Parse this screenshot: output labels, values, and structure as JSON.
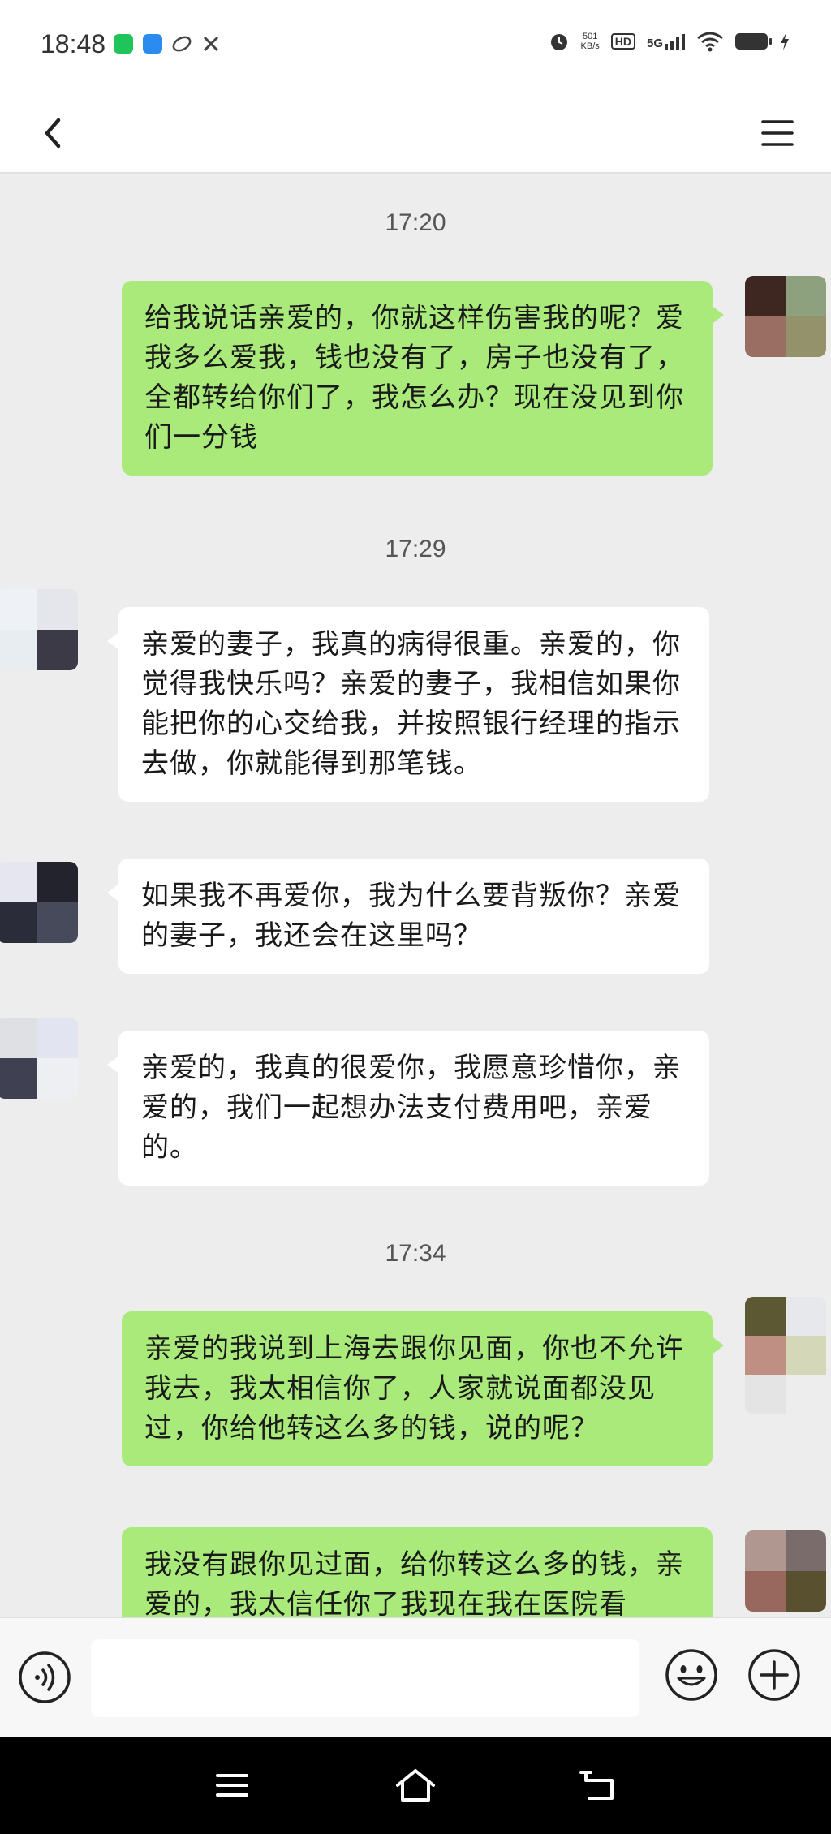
{
  "status_bar": {
    "time": "18:48",
    "net_speed_value": "501",
    "net_speed_unit": "KB/s",
    "hd_label": "HD",
    "network_label": "5G",
    "icons": [
      "green-app-icon",
      "blue-app-icon",
      "leaf-app-icon",
      "tools-icon",
      "alarm-icon",
      "hd-icon",
      "signal-icon",
      "wifi-icon",
      "battery-icon",
      "charging-icon"
    ]
  },
  "title_bar": {
    "icons": [
      "back-arrow-icon",
      "menu-icon"
    ]
  },
  "chat": {
    "timestamps": [
      "17:20",
      "17:29",
      "17:34"
    ],
    "messages": [
      {
        "side": "me",
        "text": "给我说话亲爱的，你就这样伤害我的呢？爱我多么爱我，钱也没有了，房子也没有了，全都转给你们了，我怎么办？现在没见到你们一分钱"
      },
      {
        "side": "other",
        "text": "亲爱的妻子，我真的病得很重。亲爱的，你觉得我快乐吗？亲爱的妻子，我相信如果你能把你的心交给我，并按照银行经理的指示去做，你就能得到那笔钱。"
      },
      {
        "side": "other",
        "text": "如果我不再爱你，我为什么要背叛你？亲爱的妻子，我还会在这里吗？"
      },
      {
        "side": "other",
        "text": "亲爱的，我真的很爱你，我愿意珍惜你，亲爱的，我们一起想办法支付费用吧，亲爱的。"
      },
      {
        "side": "me",
        "text": "亲爱的我说到上海去跟你见面，你也不允许我去，我太相信你了，人家就说面都没见过，你给他转这么多的钱，说的呢？"
      },
      {
        "side": "me",
        "text": "我没有跟你见过面，给你转这么多的钱，亲爱的，我太信任你了我现在我在医院看"
      }
    ]
  },
  "input_bar": {
    "value": "",
    "placeholder": "",
    "icons": [
      "voice-icon",
      "emoji-icon",
      "plus-icon"
    ]
  },
  "nav_bar": {
    "icons": [
      "recents-menu-icon",
      "home-icon",
      "back-icon"
    ]
  },
  "colors": {
    "my_bubble": "#a9ea7a",
    "other_bubble": "#ffffff",
    "chat_background": "#ededed"
  }
}
